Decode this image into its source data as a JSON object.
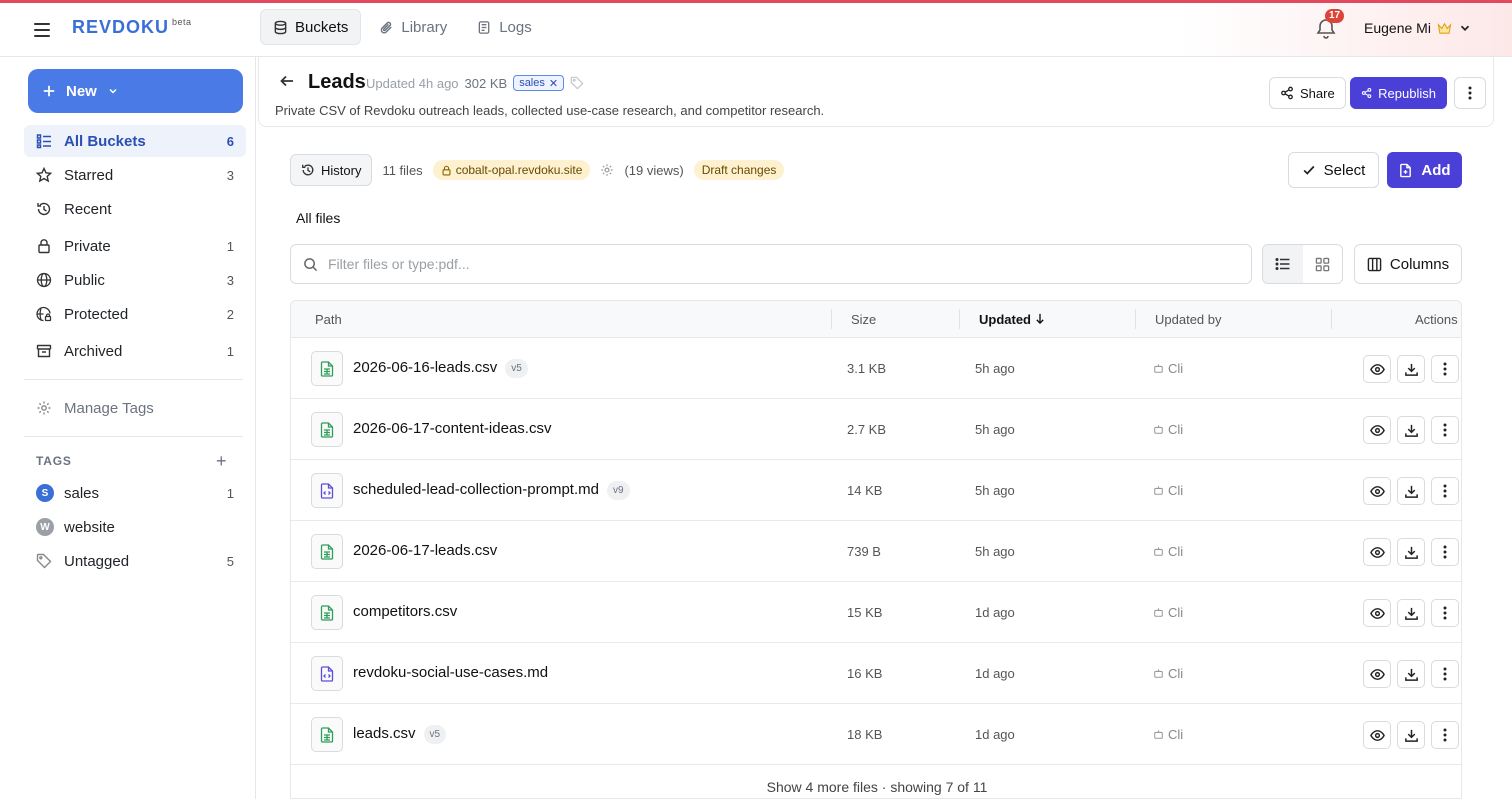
{
  "app": {
    "logo": "REVDOKU",
    "logo_badge": "beta"
  },
  "nav": {
    "tabs": [
      {
        "label": "Buckets",
        "icon": "database-icon",
        "active": true
      },
      {
        "label": "Library",
        "icon": "paperclip-icon",
        "active": false
      },
      {
        "label": "Logs",
        "icon": "logs-icon",
        "active": false
      }
    ],
    "notifications_count": "17",
    "user_name": "Eugene Mi"
  },
  "sidebar": {
    "new_label": "New",
    "items": [
      {
        "label": "All Buckets",
        "count": "6",
        "icon": "list-icon",
        "active": true
      },
      {
        "label": "Starred",
        "count": "3",
        "icon": "star-icon"
      },
      {
        "label": "Recent",
        "count": "",
        "icon": "history-icon"
      },
      {
        "label": "Private",
        "count": "1",
        "icon": "lock-icon"
      },
      {
        "label": "Public",
        "count": "3",
        "icon": "globe-icon"
      },
      {
        "label": "Protected",
        "count": "2",
        "icon": "globe-lock-icon"
      },
      {
        "label": "Archived",
        "count": "1",
        "icon": "archive-icon"
      }
    ],
    "manage_tags": "Manage Tags",
    "tags_heading": "TAGS",
    "tags": [
      {
        "label": "sales",
        "count": "1",
        "letter": "S",
        "color": "#3b6fd8"
      },
      {
        "label": "website",
        "count": "",
        "letter": "W",
        "color": "#9aa0a6"
      },
      {
        "label": "Untagged",
        "count": "5",
        "letter": "",
        "color": ""
      }
    ]
  },
  "bucket": {
    "title": "Leads",
    "updated": "Updated 4h ago",
    "size": "302 KB",
    "tag": "sales",
    "description": "Private CSV of Revdoku outreach leads, collected use-case research, and competitor research.",
    "share_label": "Share",
    "republish_label": "Republish"
  },
  "toolbar": {
    "history_label": "History",
    "file_count": "11 files",
    "site": "cobalt-opal.revdoku.site",
    "views": "(19 views)",
    "draft": "Draft changes",
    "select_label": "Select",
    "add_label": "Add",
    "section_title": "All files",
    "search_placeholder": "Filter files or type:pdf...",
    "columns_label": "Columns"
  },
  "table": {
    "headers": {
      "path": "Path",
      "size": "Size",
      "updated": "Updated",
      "updated_by": "Updated by",
      "actions": "Actions"
    },
    "rows": [
      {
        "name": "2026-06-16-leads.csv",
        "version": "v5",
        "size": "3.1 KB",
        "updated": "5h ago",
        "by": "Cli",
        "type": "csv"
      },
      {
        "name": "2026-06-17-content-ideas.csv",
        "version": "",
        "size": "2.7 KB",
        "updated": "5h ago",
        "by": "Cli",
        "type": "csv"
      },
      {
        "name": "scheduled-lead-collection-prompt.md",
        "version": "v9",
        "size": "14 KB",
        "updated": "5h ago",
        "by": "Cli",
        "type": "md"
      },
      {
        "name": "2026-06-17-leads.csv",
        "version": "",
        "size": "739 B",
        "updated": "5h ago",
        "by": "Cli",
        "type": "csv"
      },
      {
        "name": "competitors.csv",
        "version": "",
        "size": "15 KB",
        "updated": "1d ago",
        "by": "Cli",
        "type": "csv"
      },
      {
        "name": "revdoku-social-use-cases.md",
        "version": "",
        "size": "16 KB",
        "updated": "1d ago",
        "by": "Cli",
        "type": "md"
      },
      {
        "name": "leads.csv",
        "version": "v5",
        "size": "18 KB",
        "updated": "1d ago",
        "by": "Cli",
        "type": "csv"
      }
    ],
    "more_label": "Show 4 more files · showing 7 of 11"
  },
  "colors": {
    "accent": "#4a3fd6",
    "new_button": "#4a7ae6",
    "csv_icon": "#2f9e5b",
    "md_icon": "#5b4fd8",
    "draft_bg": "#fdf1cf"
  }
}
